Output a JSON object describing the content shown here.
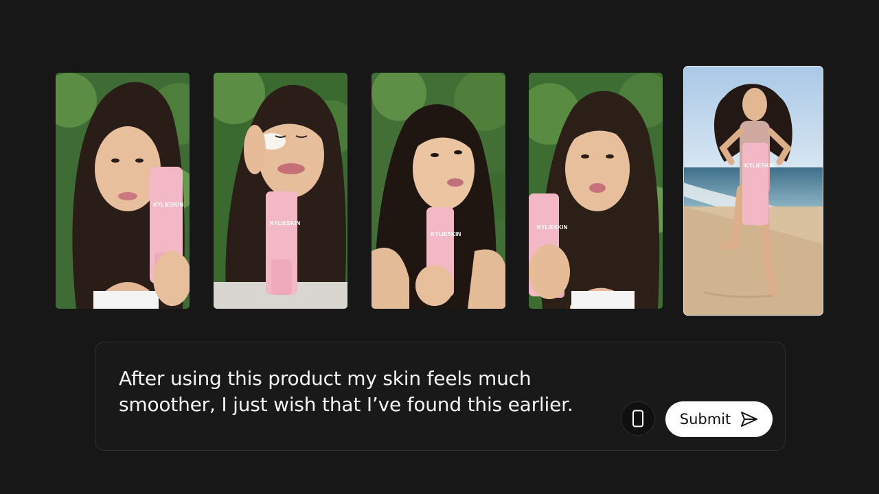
{
  "thumbnails": [
    {
      "alt": "",
      "product_label": "KYLIESKIN",
      "selected": false
    },
    {
      "alt": "",
      "product_label": "KYLIESKIN",
      "selected": false
    },
    {
      "alt": "",
      "product_label": "KYLIESKIN",
      "selected": false
    },
    {
      "alt": "",
      "product_label": "KYLIESKIN",
      "selected": false
    },
    {
      "alt": "",
      "product_label": "KYLIESKIN",
      "selected": true
    }
  ],
  "prompt": {
    "text": "After using this product my skin feels much smoother, I just wish that I’ve found this earlier."
  },
  "actions": {
    "device_icon": "smartphone-icon",
    "submit_label": "Submit",
    "submit_icon": "send-icon"
  },
  "colors": {
    "background": "#171717",
    "panel_border": "#2f2f2f",
    "tube_pink": "#f2b8c6",
    "submit_bg": "#ffffff"
  }
}
